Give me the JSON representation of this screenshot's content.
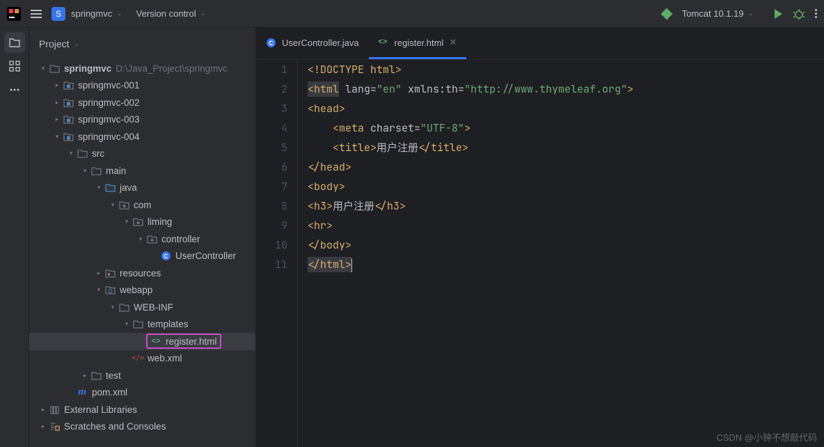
{
  "titlebar": {
    "project_badge": "S",
    "project": "springmvc",
    "vcs": "Version control",
    "tomcat": "Tomcat 10.1.19"
  },
  "panel": {
    "title": "Project"
  },
  "tree": {
    "root": {
      "name": "springmvc",
      "path": "D:\\Java_Project\\springmvc"
    },
    "modules": [
      {
        "name": "springmvc-001"
      },
      {
        "name": "springmvc-002"
      },
      {
        "name": "springmvc-003"
      },
      {
        "name": "springmvc-004"
      }
    ],
    "src": "src",
    "main": "main",
    "java": "java",
    "com": "com",
    "liming": "liming",
    "controller": "controller",
    "userController": "UserController",
    "resources": "resources",
    "webapp": "webapp",
    "webinf": "WEB-INF",
    "templates": "templates",
    "registerHtml": "register.html",
    "webxml": "web.xml",
    "test": "test",
    "pom": "pom.xml",
    "extLibs": "External Libraries",
    "scratches": "Scratches and Consoles"
  },
  "tabs": {
    "tab1": "UserController.java",
    "tab2": "register.html"
  },
  "code": {
    "lines": [
      "1",
      "2",
      "3",
      "4",
      "5",
      "6",
      "7",
      "8",
      "9",
      "10",
      "11"
    ],
    "l1_a": "<!DOCTYPE",
    "l1_b": " html>",
    "l2_a": "<html",
    "l2_attr": " lang=",
    "l2_val": "\"en\"",
    "l2_attr2": " xmlns:th=",
    "l2_val2": "\"http://www.thymeleaf.org\"",
    "l2_end": ">",
    "l3": "<head>",
    "l4_pad": "    ",
    "l4_a": "<meta",
    "l4_attr": " charset=",
    "l4_val": "\"UTF-8\"",
    "l4_end": ">",
    "l5_pad": "    ",
    "l5_a": "<title>",
    "l5_txt": "用户注册",
    "l5_b": "</title>",
    "l6": "</head>",
    "l7": "<body>",
    "l8_a": "<h3>",
    "l8_txt": "用户注册",
    "l8_b": "</h3>",
    "l9": "<hr>",
    "l10": "</body>",
    "l11": "</html>"
  },
  "watermark": "CSDN @小钟不想敲代码"
}
